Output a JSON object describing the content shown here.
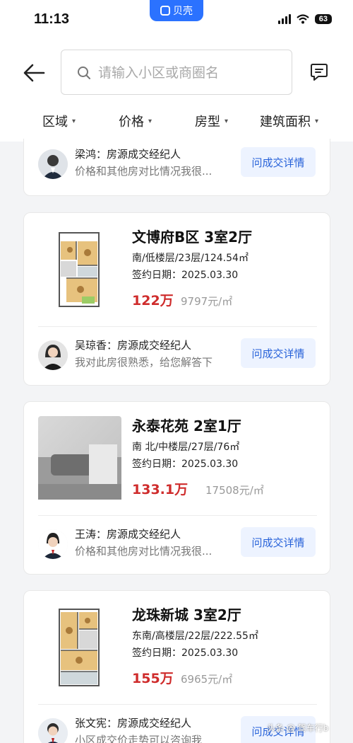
{
  "status_bar": {
    "time": "11:13",
    "app_name": "贝壳",
    "battery": "63"
  },
  "search": {
    "placeholder": "请输入小区或商圈名"
  },
  "filters": [
    {
      "label": "区域"
    },
    {
      "label": "价格"
    },
    {
      "label": "房型"
    },
    {
      "label": "建筑面积"
    }
  ],
  "listings": [
    {
      "partial": true,
      "agent": {
        "name": "梁鸿：房源成交经纪人",
        "note": "价格和其他房对比情况我很..."
      },
      "ask_label": "问成交详情"
    },
    {
      "title": "文博府B区 3室2厅",
      "meta": "南/低楼层/23层/124.54㎡",
      "date": "签约日期：2025.03.30",
      "price": "122万",
      "unit_price": "9797元/㎡",
      "thumb": "floorplan",
      "agent": {
        "name": "吴琼香：房源成交经纪人",
        "note": "我对此房很熟悉，给您解答下"
      },
      "ask_label": "问成交详情"
    },
    {
      "title": "永泰花苑 2室1厅",
      "meta": "南 北/中楼层/27层/76㎡",
      "date": "签约日期：2025.03.30",
      "price": "133.1万",
      "unit_price": "17508元/㎡",
      "thumb": "photo",
      "agent": {
        "name": "王涛：房源成交经纪人",
        "note": "价格和其他房对比情况我很..."
      },
      "ask_label": "问成交详情"
    },
    {
      "title": "龙珠新城 3室2厅",
      "meta": "东南/高楼层/22层/222.55㎡",
      "date": "签约日期：2025.03.30",
      "price": "155万",
      "unit_price": "6965元/㎡",
      "thumb": "floorplan",
      "agent": {
        "name": "张文宪：房源成交经纪人",
        "note": "小区成交价走势可以咨询我"
      },
      "ask_label": "问成交详情"
    }
  ],
  "watermark": "头条 @ 驾车行b",
  "colors": {
    "accent": "#2b72ff",
    "price": "#cf2c2c",
    "button_bg": "#edf3ff",
    "button_text": "#2762d9"
  },
  "icons": [
    "back-arrow-icon",
    "search-icon",
    "message-icon",
    "floorplan-icon"
  ]
}
